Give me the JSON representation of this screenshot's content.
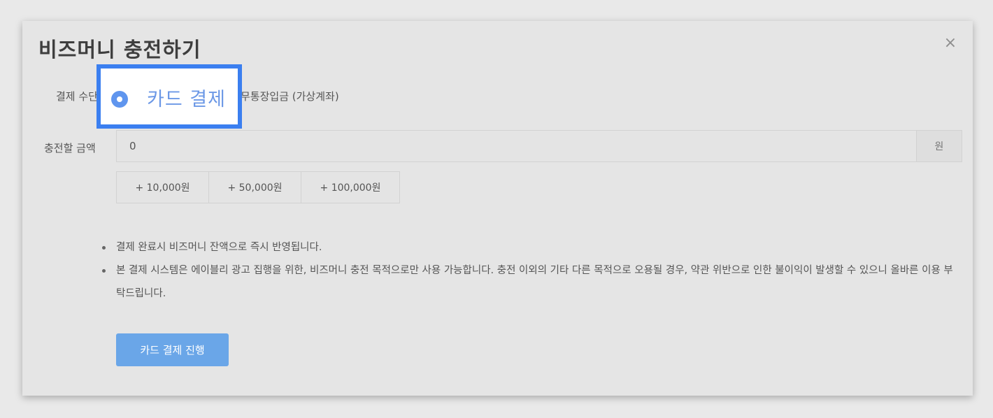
{
  "modal": {
    "title": "비즈머니 충전하기",
    "close_icon": "×"
  },
  "form": {
    "payment_method_label": "결제 수단",
    "payment_options": [
      {
        "label": "카드 결제",
        "selected": true
      },
      {
        "label": "무통장입금 (가상계좌)",
        "selected": false
      }
    ],
    "amount_label": "충전할 금액",
    "amount_value": "0",
    "amount_unit": "원",
    "quick_amounts": [
      "+ 10,000원",
      "+ 50,000원",
      "+ 100,000원"
    ]
  },
  "notices": [
    "결제 완료시 비즈머니 잔액으로 즉시 반영됩니다.",
    "본 결제 시스템은 에이블리 광고 집행을 위한, 비즈머니 충전 목적으로만 사용 가능합니다. 충전 이외의 기타 다른 목적으로 오용될 경우, 약관 위반으로 인한 불이익이 발생할 수 있으니 올바른 이용 부탁드립니다."
  ],
  "submit_label": "카드 결제 진행",
  "colors": {
    "accent": "#3b7ff0",
    "radio": "#5f95ee",
    "submit": "#6aa6e8",
    "backdrop": "#e9e9e9"
  }
}
